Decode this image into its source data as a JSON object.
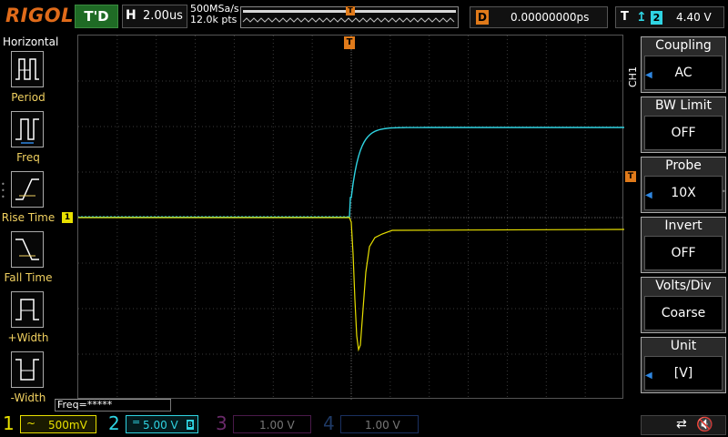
{
  "header": {
    "logo": "RIGOL",
    "run_status": "T'D",
    "timebase_letter": "H",
    "timebase": "2.00us",
    "sample_rate": "500MSa/s",
    "memory_depth": "12.0k pts",
    "trigger_position_marker": "T",
    "delay_letter": "D",
    "delay_value": "0.00000000ps",
    "trigger_letter": "T",
    "trigger_edge_icon": "rising-edge-icon",
    "trigger_source": "2",
    "trigger_level": "4.40 V"
  },
  "left_menu": {
    "title": "Horizontal",
    "items": [
      {
        "label": "Period",
        "icon": "period-icon"
      },
      {
        "label": "Freq",
        "icon": "frequency-icon"
      },
      {
        "label": "Rise Time",
        "icon": "rise-time-icon"
      },
      {
        "label": "Fall Time",
        "icon": "fall-time-icon"
      },
      {
        "label": "+Width",
        "icon": "positive-width-icon"
      },
      {
        "label": "-Width",
        "icon": "negative-width-icon"
      }
    ]
  },
  "scope": {
    "trigger_time_marker": "T",
    "ch1_marker": "1",
    "trigger_level_marker": "T",
    "freq_counter": "Freq=*****"
  },
  "right_menu": {
    "channel_tab": "CH1",
    "items": [
      {
        "title": "Coupling",
        "value": "AC"
      },
      {
        "title": "BW Limit",
        "value": "OFF"
      },
      {
        "title": "Probe",
        "value": "10X"
      },
      {
        "title": "Invert",
        "value": "OFF"
      },
      {
        "title": "Volts/Div",
        "value": "Coarse"
      },
      {
        "title": "Unit",
        "value": "[V]"
      }
    ]
  },
  "channels": {
    "ch1": {
      "number": "1",
      "coupling": "~",
      "scale": "500mV",
      "color": "#e8e000"
    },
    "ch2": {
      "number": "2",
      "coupling": "=",
      "scale": "5.00 V",
      "bw_icon": "B",
      "color": "#2fd4e2"
    },
    "ch3": {
      "number": "3",
      "scale": "1.00 V",
      "color": "#6a2a6a"
    },
    "ch4": {
      "number": "4",
      "scale": "1.00 V",
      "color": "#1f3a66"
    }
  },
  "status": {
    "usb_icon": "usb-icon",
    "speaker_icon": "speaker-muted-icon"
  },
  "waveforms": {
    "grid": {
      "h_divs": 14,
      "v_divs": 8
    },
    "ch2_trace": {
      "description_units": "divisions from left edge / divisions from top",
      "color": "#2fd4e2"
    },
    "ch1_trace": {
      "color": "#e8e000"
    }
  }
}
